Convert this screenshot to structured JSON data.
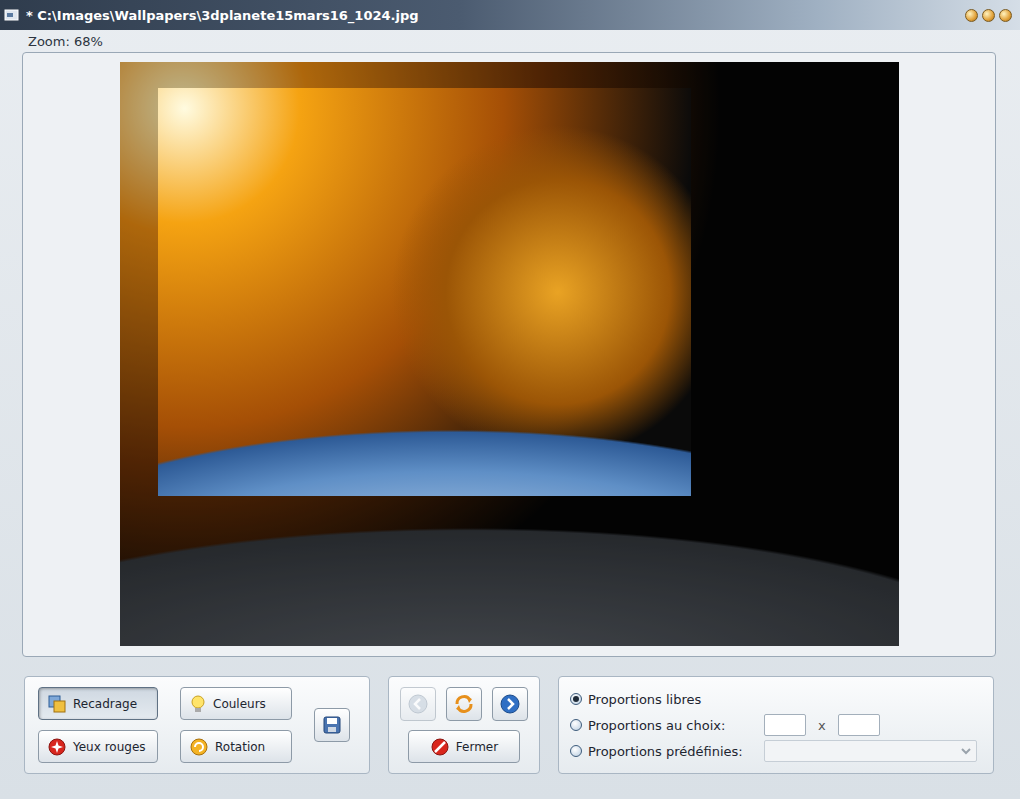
{
  "window": {
    "title": "* C:\\Images\\Wallpapers\\3dplanete15mars16_1024.jpg"
  },
  "zoom": "Zoom: 68%",
  "tools": [
    {
      "label": "Recadrage",
      "selected": true
    },
    {
      "label": "Couleurs",
      "selected": false
    },
    {
      "label": "Yeux rouges",
      "selected": false
    },
    {
      "label": "Rotation",
      "selected": false
    }
  ],
  "navigation": [
    {
      "disabled": true
    },
    {
      "disabled": false
    },
    {
      "disabled": false
    }
  ],
  "close_button": "Fermer",
  "proportions": [
    {
      "label": "Proportions libres",
      "selected": true,
      "kind": "plain"
    },
    {
      "label": "Proportions au choix:",
      "selected": false,
      "kind": "custom",
      "separator": "x",
      "width": "",
      "height": ""
    },
    {
      "label": "Proportions prédéfinies:",
      "selected": false,
      "kind": "preset",
      "value": ""
    }
  ]
}
